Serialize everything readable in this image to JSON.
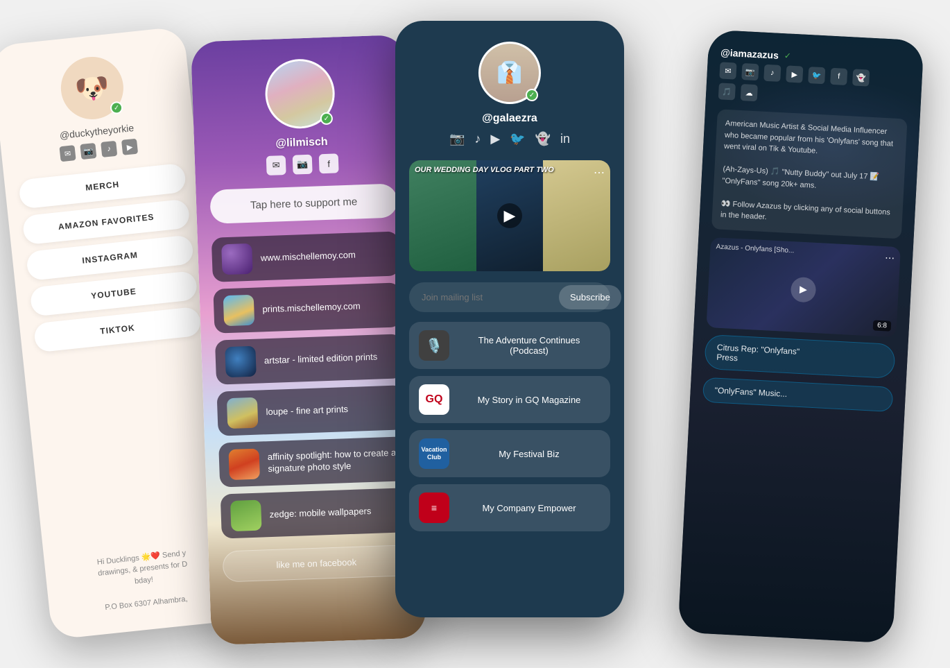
{
  "card1": {
    "username": "@duckytheyorkie",
    "avatar_emoji": "🐶",
    "buttons": [
      "MERCH",
      "AMAZON FAVORITES",
      "INSTAGRAM",
      "YOUTUBE",
      "TIKTOK"
    ],
    "bottom_text": "Hi Ducklings 🌟❤️ Send y drawings, & presents for D bday!\n\nP.O Box 6307 Alhambra,",
    "social_icons": [
      "✉",
      "📷",
      "♪",
      "▶"
    ]
  },
  "card2": {
    "username": "@lilmisch",
    "support_text": "Tap here to support me",
    "social_icons": [
      "✉",
      "📷",
      "f"
    ],
    "links": [
      {
        "text": "www.mischellemoy.com",
        "thumb": "purple"
      },
      {
        "text": "prints.mischellemoy.com",
        "thumb": "beach"
      },
      {
        "text": "artstar - limited edition prints",
        "thumb": "blue-circle"
      },
      {
        "text": "loupe - fine art prints",
        "thumb": "landscape"
      },
      {
        "text": "affinity spotlight: how to create a signature photo style",
        "thumb": "orange"
      },
      {
        "text": "zedge: mobile wallpapers",
        "thumb": "orange2"
      }
    ],
    "last_button": "like me on facebook"
  },
  "card3": {
    "username": "@galaezra",
    "social_icons": [
      "📷",
      "♪",
      "▶",
      "🐦",
      "👻",
      "in"
    ],
    "video_title": "OUR WEDDING DAY VLOG PART TWO",
    "mail_placeholder": "Join mailing list",
    "subscribe_label": "Subscribe",
    "links": [
      {
        "text": "The Adventure Continues\n(Podcast)",
        "icon": "mic"
      },
      {
        "text": "My Story in GQ Magazine",
        "icon": "gq"
      },
      {
        "text": "My Festival Biz",
        "icon": "vc"
      },
      {
        "text": "My Company Empower",
        "icon": "red"
      }
    ]
  },
  "card4": {
    "username": "@iamazazus",
    "verified": "✓",
    "social_icons1": [
      "✉",
      "📷",
      "♪",
      "▶",
      "🐦",
      "f",
      "👻"
    ],
    "social_icons2": [
      "🎵",
      "☁"
    ],
    "description": "American Music Artist & Social Media Influencer who became popular from his 'Onlyfans' song that went viral on Tik & Youtube.\n\n(Ah-Zays-Us) 🎵 \"Nutty Buddy\" out July 17 📝 \"OnlyFans\" song 20k+ ams.\n\n👀 Follow Azazus by clicking any of social buttons in the header.",
    "video_label": "Azazus - Onlyfans [Sho...",
    "links": [
      {
        "text": "Citrus Rep: \"Onlyfans\"\nPress"
      }
    ]
  }
}
